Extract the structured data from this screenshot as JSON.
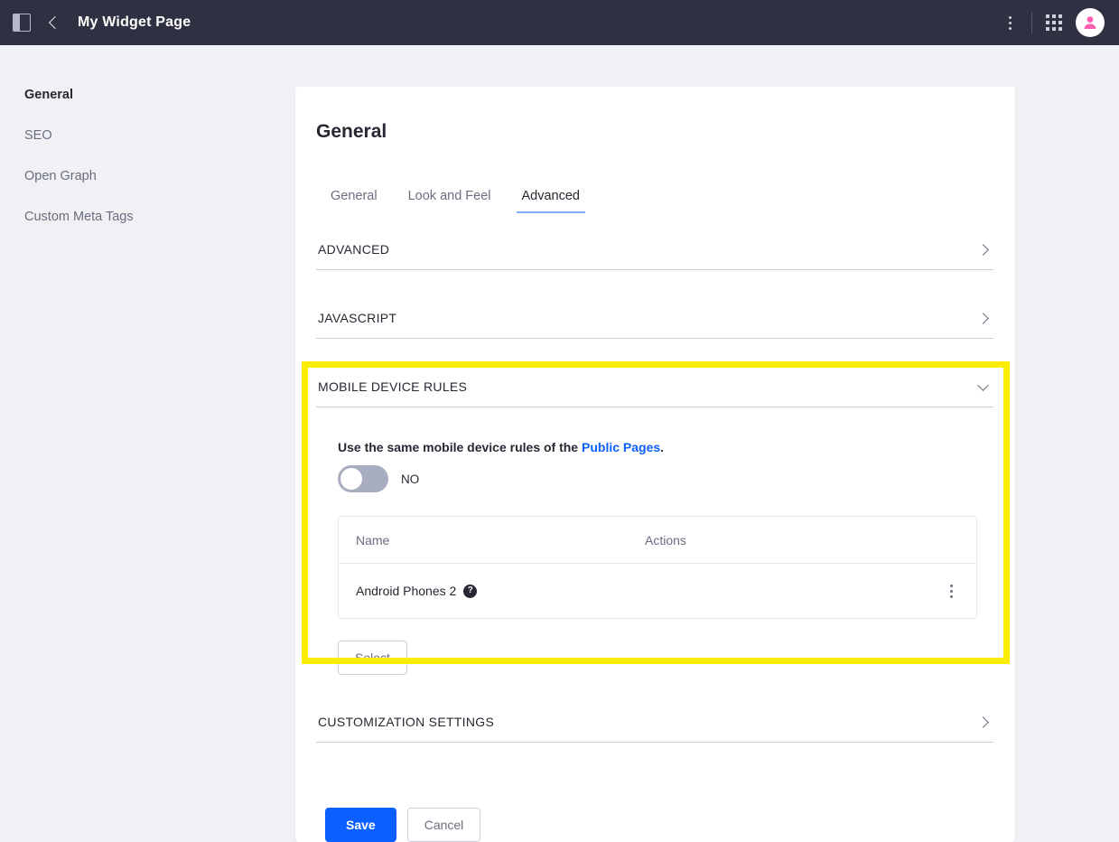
{
  "topbar": {
    "panel_toggle_name": "sidebar-toggle-icon",
    "back_label": "back",
    "title": "My Widget Page",
    "kebab_label": "more options",
    "apps_label": "applications",
    "avatar_label": "user avatar"
  },
  "sidenav": {
    "items": [
      {
        "label": "General",
        "active": true
      },
      {
        "label": "SEO",
        "active": false
      },
      {
        "label": "Open Graph",
        "active": false
      },
      {
        "label": "Custom Meta Tags",
        "active": false
      }
    ]
  },
  "main": {
    "title": "General",
    "tabs": [
      {
        "label": "General",
        "active": false
      },
      {
        "label": "Look and Feel",
        "active": false
      },
      {
        "label": "Advanced",
        "active": true
      }
    ],
    "sections": {
      "advanced": {
        "label": "ADVANCED",
        "expanded": false
      },
      "javascript": {
        "label": "JAVASCRIPT",
        "expanded": false
      },
      "mobile_device_rules": {
        "label": "MOBILE DEVICE RULES",
        "expanded": true,
        "highlighted": true,
        "highlight_color": "#fbec00",
        "description_prefix": "Use the same mobile device rules of the ",
        "description_link": "Public Pages",
        "description_suffix": ".",
        "toggle": {
          "state_label": "NO",
          "checked": false
        },
        "table": {
          "columns": [
            "Name",
            "Actions"
          ],
          "rows": [
            {
              "name": "Android Phones 2",
              "badge": "?",
              "actions_icon": "kebab-icon"
            }
          ]
        },
        "select_button": "Select"
      },
      "customization_settings": {
        "label": "CUSTOMIZATION SETTINGS",
        "expanded": false
      }
    },
    "footer": {
      "save_label": "Save",
      "cancel_label": "Cancel"
    }
  },
  "colors": {
    "topbar_bg": "#2f3142",
    "page_bg": "#f0f1f5",
    "primary": "#0b5fff",
    "link": "#0b5fff",
    "highlight": "#fbec00",
    "accent_pink": "#ff69b4"
  }
}
